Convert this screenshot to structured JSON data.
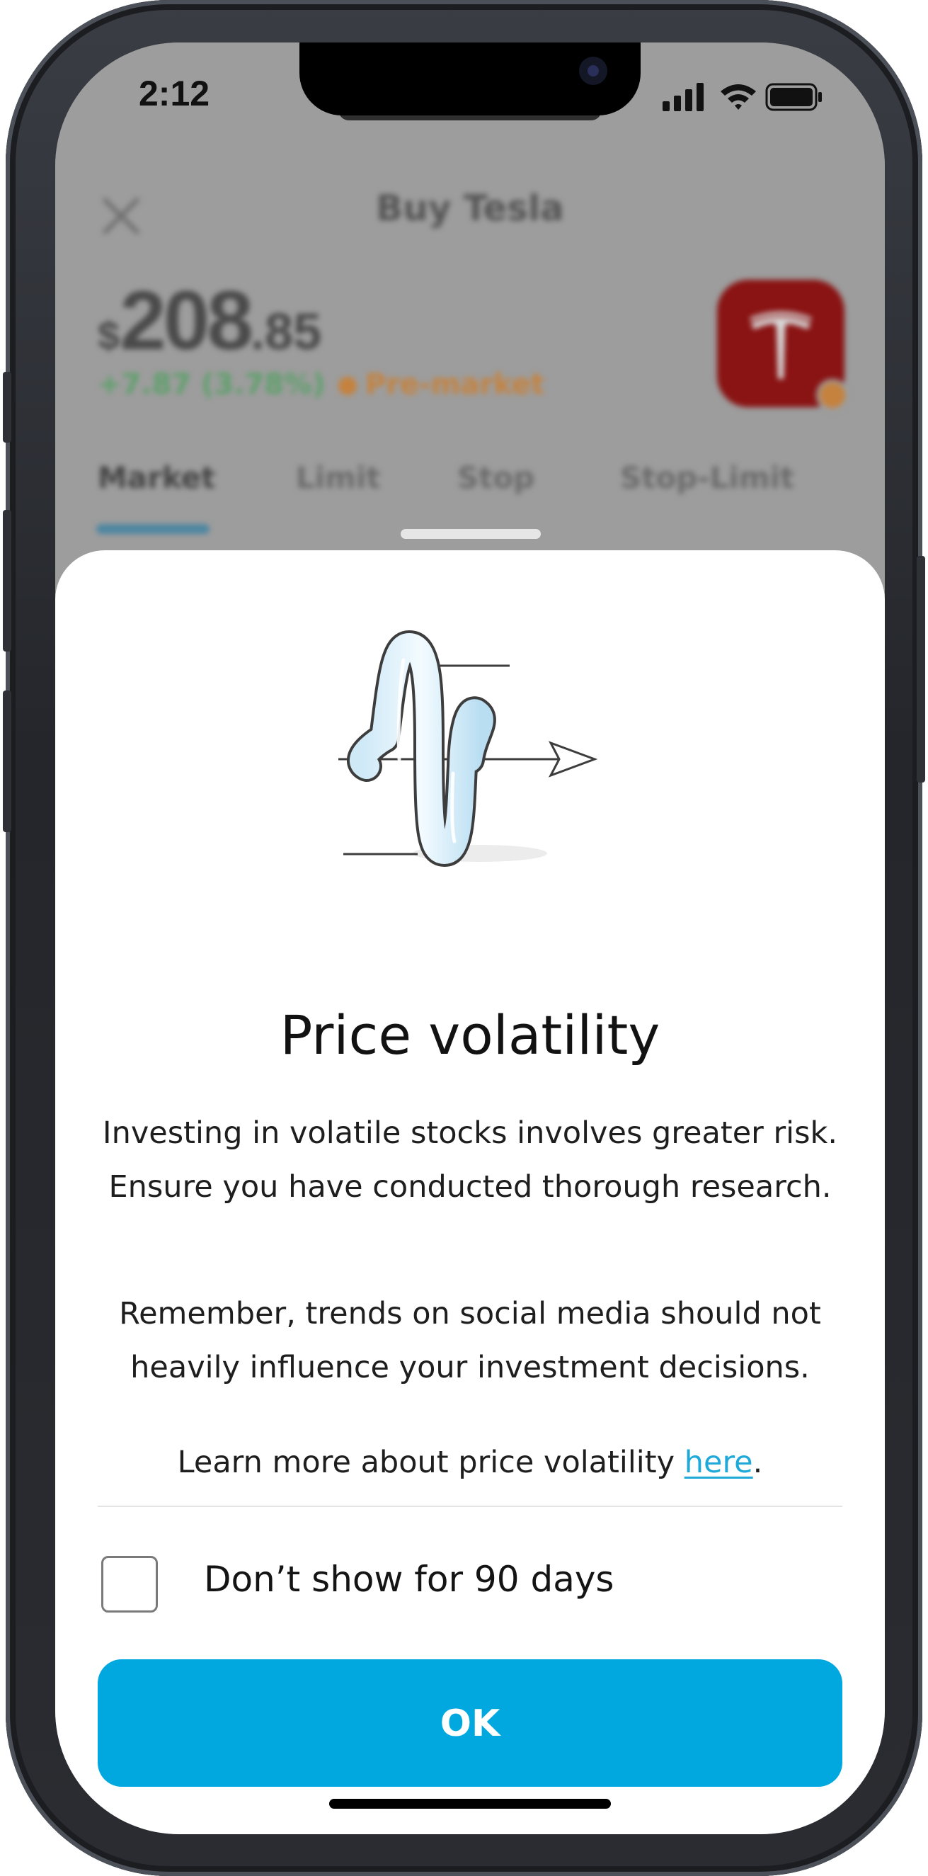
{
  "status_bar": {
    "time": "2:12",
    "icons": [
      "cellular-signal-icon",
      "wifi-icon",
      "battery-icon"
    ]
  },
  "background_screen": {
    "title": "Buy Tesla",
    "price": {
      "currency": "$",
      "whole": "208",
      "decimal": ".85"
    },
    "change": "+7.87 (3.78%)",
    "session": "Pre-market",
    "order_tabs": [
      "Market",
      "Limit",
      "Stop",
      "Stop-Limit"
    ],
    "active_tab": "Market"
  },
  "sheet": {
    "illustration": "price-volatility-wave-icon",
    "title": "Price volatility",
    "paragraph_1": "Investing in volatile stocks involves greater risk. Ensure you have conducted thorough research.",
    "paragraph_2": "Remember, trends on social media should not heavily influence your investment decisions.",
    "learn_more_prefix": "Learn more about price volatility ",
    "learn_more_link": "here",
    "learn_more_suffix": ".",
    "checkbox_label": "Don’t show for 90 days",
    "checkbox_checked": false,
    "ok_label": "OK"
  },
  "colors": {
    "accent": "#00a8df",
    "link": "#1fa9d8",
    "tesla_red": "#8a1313"
  }
}
